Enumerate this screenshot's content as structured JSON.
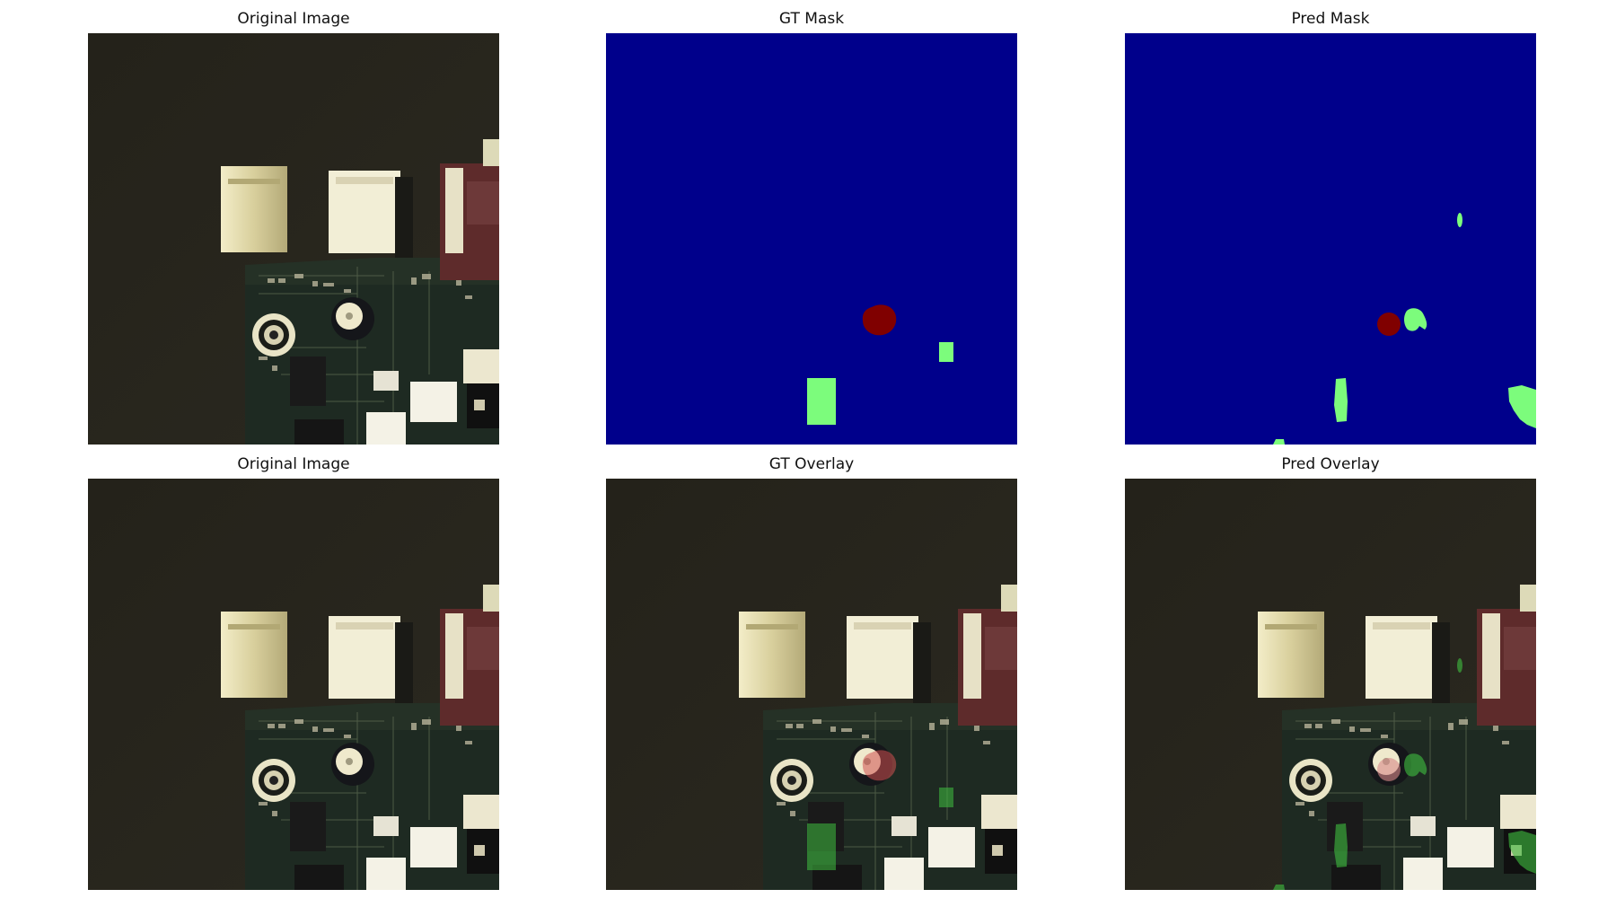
{
  "figure": {
    "panels": [
      {
        "id": "orig-1",
        "title": "Original Image",
        "kind": "photo"
      },
      {
        "id": "gt-mask",
        "title": "GT Mask",
        "kind": "gt-mask"
      },
      {
        "id": "pred-mask",
        "title": "Pred Mask",
        "kind": "pred-mask"
      },
      {
        "id": "orig-2",
        "title": "Original Image",
        "kind": "photo"
      },
      {
        "id": "gt-overlay",
        "title": "GT Overlay",
        "kind": "gt-overlay"
      },
      {
        "id": "pred-overlay",
        "title": "Pred Overlay",
        "kind": "pred-overlay"
      }
    ]
  },
  "colors": {
    "mask_background": "#00008b",
    "class_red": "#800000",
    "class_green": "#7cfc7c",
    "photo_background": "#25231a"
  }
}
